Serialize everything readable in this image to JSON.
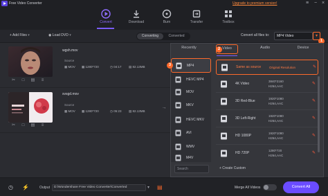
{
  "app": {
    "title": "Free Video Converter",
    "upgrade_link": "Upgrade to premium version!"
  },
  "window_controls": {
    "menu_icon": "≡",
    "minimize_icon": "−",
    "close_icon": "×"
  },
  "nav": {
    "items": [
      {
        "label": "Convert",
        "icon": "convert-icon",
        "active": true
      },
      {
        "label": "Download",
        "icon": "download-icon",
        "active": false
      },
      {
        "label": "Burn",
        "icon": "burn-icon",
        "active": false
      },
      {
        "label": "Transfer",
        "icon": "transfer-icon",
        "active": false
      },
      {
        "label": "Toolbox",
        "icon": "toolbox-icon",
        "active": false
      }
    ]
  },
  "toolbar": {
    "add_files": "Add Files",
    "load_dvd": "Load DVD",
    "segments": [
      "Converting",
      "Converted"
    ],
    "convert_all_files_to": "Convert all files to:",
    "format_value": "MP4 Video",
    "format_dropdown_icon": "▾"
  },
  "files": [
    {
      "name": "wgsh.mov",
      "source_label": "Source",
      "format": "MOV",
      "resolution": "1280*720",
      "duration": "04:17",
      "size": "82.13MB"
    },
    {
      "name": "svsgd.mov",
      "source_label": "Source",
      "format": "MOV",
      "resolution": "1280*720",
      "duration": "05:23",
      "size": "82.13MB"
    }
  ],
  "format_panel": {
    "tabs": [
      "Recently",
      "Video",
      "Audio",
      "Device"
    ],
    "active_tab": "Video",
    "formats": [
      "MP4",
      "HEVC MP4",
      "MOV",
      "MKV",
      "HEVC MKV",
      "AVI",
      "WMV",
      "M4V"
    ],
    "selected_format": "MP4",
    "resolutions": [
      {
        "name": "Same as source",
        "resolution": "Original Resolution",
        "codec": ""
      },
      {
        "name": "4K Video",
        "resolution": "3840*2160",
        "codec": "H264,AAC"
      },
      {
        "name": "3D Red-Blue",
        "resolution": "1920*1080",
        "codec": "H264,AAC"
      },
      {
        "name": "3D Left-Right",
        "resolution": "1920*1080",
        "codec": "H264,AAC"
      },
      {
        "name": "HD 1080P",
        "resolution": "1920*1080",
        "codec": "H264,AAC"
      },
      {
        "name": "HD 720P",
        "resolution": "1280*720",
        "codec": "H264,AAC"
      }
    ],
    "search_placeholder": "Search",
    "create_custom": "+ Create Custom",
    "badges": [
      "1",
      "2",
      "3"
    ]
  },
  "footer": {
    "output_label": "Output",
    "output_path": "D:\\Wondershare Free Video Converter\\Converted",
    "merge_label": "Merge All Videos",
    "merge_enabled": false,
    "convert_all": "Convert All"
  },
  "colors": {
    "accent": "#7b5cff",
    "highlight": "#ff6a2b",
    "background": "#2b2c31"
  }
}
